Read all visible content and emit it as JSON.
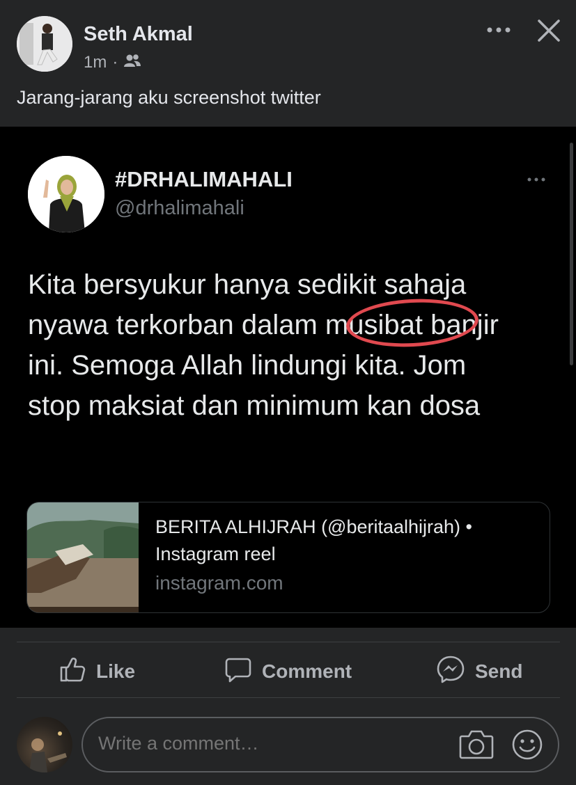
{
  "post": {
    "author": "Seth Akmal",
    "time": "1m",
    "separator": "·",
    "audience_icon": "friends-icon",
    "caption": "Jarang-jarang aku screenshot twitter"
  },
  "tweet": {
    "name": "#DRHALIMAHALI",
    "handle": "@drhalimahali",
    "lines": [
      "Kita bersyukur hanya sedikit sahaja",
      "nyawa terkorban dalam musibat banjir",
      "ini. Semoga Allah lindungi kita. Jom",
      "stop maksiat dan minimum kan dosa"
    ],
    "highlight_color": "#e0494f",
    "card": {
      "source": "BERITA ALHIJRAH (@beritaalhijrah) •",
      "title": "Instagram reel",
      "domain": "instagram.com"
    }
  },
  "actions": {
    "like": "Like",
    "comment": "Comment",
    "send": "Send"
  },
  "composer": {
    "placeholder": "Write a comment…"
  },
  "colors": {
    "background": "#242526",
    "tweet_background": "#000000",
    "text_primary": "#e4e6eb",
    "text_secondary": "#b0b3b8"
  }
}
